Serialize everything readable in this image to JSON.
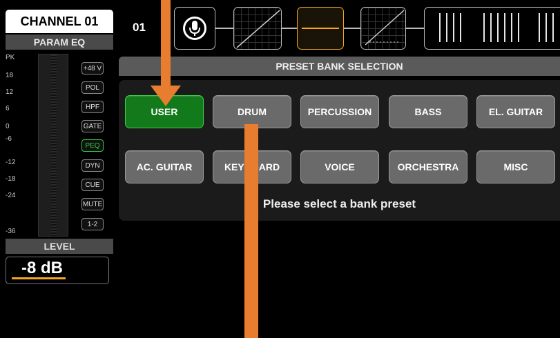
{
  "channel": {
    "title": "CHANNEL 01",
    "mode": "PARAM EQ",
    "number": "01"
  },
  "meter_scale": [
    "PK",
    "18",
    "12",
    "6",
    "0",
    "-6",
    "-12",
    "-18",
    "-24",
    "-36"
  ],
  "tags": [
    {
      "label": "+48 V",
      "active": false
    },
    {
      "label": "POL",
      "active": false
    },
    {
      "label": "HPF",
      "active": false
    },
    {
      "label": "GATE",
      "active": false
    },
    {
      "label": "PEQ",
      "active": true
    },
    {
      "label": "DYN",
      "active": false
    },
    {
      "label": "CUE",
      "active": false
    },
    {
      "label": "MUTE",
      "active": false
    },
    {
      "label": "1-2",
      "active": false
    }
  ],
  "level": {
    "label": "LEVEL",
    "value": "-8 dB",
    "fill": 0.58
  },
  "preset": {
    "header": "PRESET BANK SELECTION",
    "buttons": [
      "USER",
      "DRUM",
      "PERCUSSION",
      "BASS",
      "EL. GUITAR",
      "AC. GUITAR",
      "KEYBOARD",
      "VOICE",
      "ORCHESTRA",
      "MISC"
    ],
    "selected": "USER",
    "message": "Please select a bank preset"
  },
  "colors": {
    "accent": "#f5a623",
    "selected": "#127a1a",
    "arrow": "#e87d2f"
  },
  "icons": {
    "mic": "microphone-icon"
  }
}
